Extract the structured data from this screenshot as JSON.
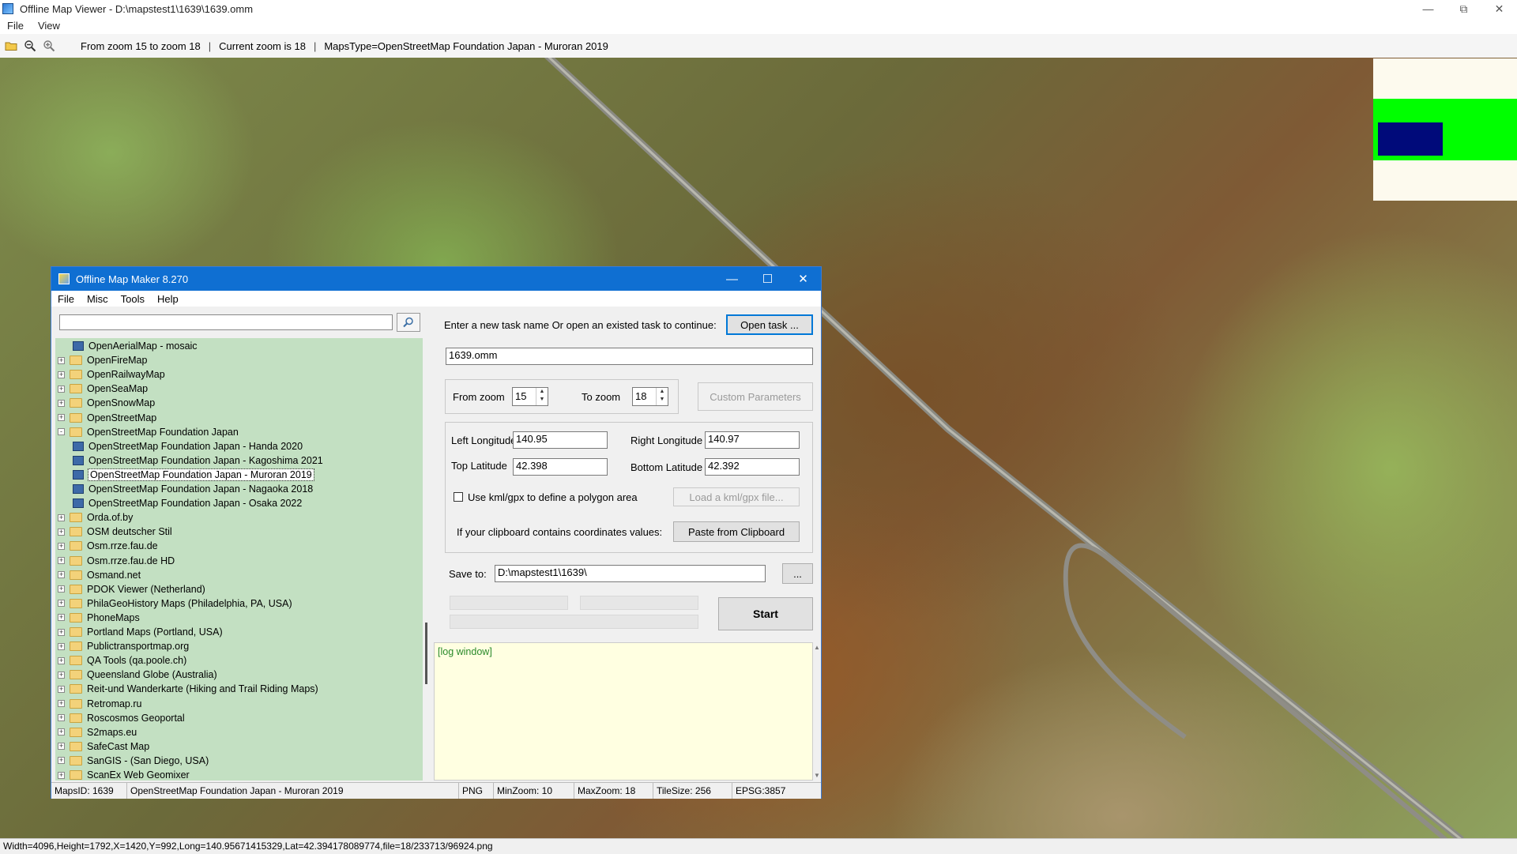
{
  "viewer": {
    "title": "Offline Map Viewer - D:\\mapstest1\\1639\\1639.omm",
    "menu": [
      "File",
      "View"
    ],
    "toolbar_info": {
      "zoom_range": "From zoom 15 to zoom 18",
      "separator": "|",
      "current_zoom": "Current zoom is 18",
      "maps_type": "MapsType=OpenStreetMap Foundation Japan - Muroran 2019"
    },
    "status": "Width=4096,Height=1792,X=1420,Y=992,Long=140.95671415329,Lat=42.394178089774,file=18/233713/96924.png",
    "minimap_colors": {
      "background": "#fdfaee",
      "green": "#00ff00",
      "blue": "#000a7a"
    }
  },
  "maker": {
    "title": "Offline Map Maker 8.270",
    "menu": [
      "File",
      "Misc",
      "Tools",
      "Help"
    ],
    "search_value": "",
    "tree": [
      {
        "level": 1,
        "type": "map",
        "label": "OpenAerialMap - mosaic"
      },
      {
        "level": 0,
        "type": "folder",
        "expand": "+",
        "label": "OpenFireMap"
      },
      {
        "level": 0,
        "type": "folder",
        "expand": "+",
        "label": "OpenRailwayMap"
      },
      {
        "level": 0,
        "type": "folder",
        "expand": "+",
        "label": "OpenSeaMap"
      },
      {
        "level": 0,
        "type": "folder",
        "expand": "+",
        "label": "OpenSnowMap"
      },
      {
        "level": 0,
        "type": "folder",
        "expand": "+",
        "label": "OpenStreetMap"
      },
      {
        "level": 0,
        "type": "folder",
        "expand": "-",
        "label": "OpenStreetMap Foundation Japan"
      },
      {
        "level": 1,
        "type": "map",
        "label": "OpenStreetMap Foundation Japan - Handa 2020"
      },
      {
        "level": 1,
        "type": "map",
        "label": "OpenStreetMap Foundation Japan - Kagoshima 2021"
      },
      {
        "level": 1,
        "type": "map",
        "label": "OpenStreetMap Foundation Japan - Muroran 2019",
        "selected": true
      },
      {
        "level": 1,
        "type": "map",
        "label": "OpenStreetMap Foundation Japan - Nagaoka 2018"
      },
      {
        "level": 1,
        "type": "map",
        "label": "OpenStreetMap Foundation Japan - Osaka 2022"
      },
      {
        "level": 0,
        "type": "folder",
        "expand": "+",
        "label": "Orda.of.by"
      },
      {
        "level": 0,
        "type": "folder",
        "expand": "+",
        "label": "OSM deutscher Stil"
      },
      {
        "level": 0,
        "type": "folder",
        "expand": "+",
        "label": "Osm.rrze.fau.de"
      },
      {
        "level": 0,
        "type": "folder",
        "expand": "+",
        "label": "Osm.rrze.fau.de HD"
      },
      {
        "level": 0,
        "type": "folder",
        "expand": "+",
        "label": "Osmand.net"
      },
      {
        "level": 0,
        "type": "folder",
        "expand": "+",
        "label": "PDOK Viewer (Netherland)"
      },
      {
        "level": 0,
        "type": "folder",
        "expand": "+",
        "label": "PhilaGeoHistory Maps (Philadelphia, PA, USA)"
      },
      {
        "level": 0,
        "type": "folder",
        "expand": "+",
        "label": "PhoneMaps"
      },
      {
        "level": 0,
        "type": "folder",
        "expand": "+",
        "label": "Portland Maps (Portland, USA)"
      },
      {
        "level": 0,
        "type": "folder",
        "expand": "+",
        "label": "Publictransportmap.org"
      },
      {
        "level": 0,
        "type": "folder",
        "expand": "+",
        "label": "QA Tools (qa.poole.ch)"
      },
      {
        "level": 0,
        "type": "folder",
        "expand": "+",
        "label": "Queensland Globe (Australia)"
      },
      {
        "level": 0,
        "type": "folder",
        "expand": "+",
        "label": "Reit-und Wanderkarte (Hiking and Trail Riding Maps)"
      },
      {
        "level": 0,
        "type": "folder",
        "expand": "+",
        "label": "Retromap.ru"
      },
      {
        "level": 0,
        "type": "folder",
        "expand": "+",
        "label": "Roscosmos Geoportal"
      },
      {
        "level": 0,
        "type": "folder",
        "expand": "+",
        "label": "S2maps.eu"
      },
      {
        "level": 0,
        "type": "folder",
        "expand": "+",
        "label": "SafeCast Map"
      },
      {
        "level": 0,
        "type": "folder",
        "expand": "+",
        "label": "SanGIS - (San Diego, USA)"
      },
      {
        "level": 0,
        "type": "folder",
        "expand": "+",
        "label": "ScanEx Web Geomixer"
      }
    ],
    "task_prompt": "Enter a new task name Or open an existed task to continue:",
    "open_task_label": "Open task ...",
    "task_name": "1639.omm",
    "from_zoom_label": "From zoom",
    "from_zoom": "15",
    "to_zoom_label": "To zoom",
    "to_zoom": "18",
    "custom_params_label": "Custom Parameters",
    "left_longitude_label": "Left Longitude",
    "left_longitude": "140.95",
    "right_longitude_label": "Right Longitude",
    "right_longitude": "140.97",
    "top_latitude_label": "Top Latitude",
    "top_latitude": "42.398",
    "bottom_latitude_label": "Bottom Latitude",
    "bottom_latitude": "42.392",
    "kml_checkbox_label": "Use kml/gpx to define a polygon area",
    "load_kml_label": "Load a kml/gpx file...",
    "clipboard_prompt": "If your clipboard contains coordinates values:",
    "paste_label": "Paste from Clipboard",
    "save_to_label": "Save to:",
    "save_to": "D:\\mapstest1\\1639\\",
    "browse_label": "...",
    "start_label": "Start",
    "log_text": "[log window]",
    "status": {
      "maps_id": "MapsID: 1639",
      "map_name": "OpenStreetMap Foundation Japan - Muroran 2019",
      "format": "PNG",
      "min_zoom": "MinZoom: 10",
      "max_zoom": "MaxZoom: 18",
      "tile_size": "TileSize: 256",
      "epsg": "EPSG:3857"
    }
  }
}
